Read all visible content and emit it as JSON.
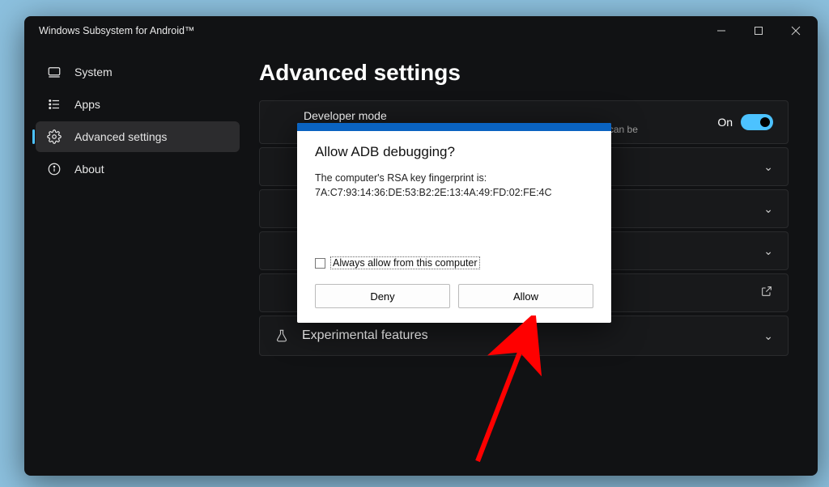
{
  "window": {
    "title": "Windows Subsystem for Android™"
  },
  "sidebar": {
    "items": [
      {
        "label": "System"
      },
      {
        "label": "Apps"
      },
      {
        "label": "Advanced settings"
      },
      {
        "label": "About"
      }
    ]
  },
  "page": {
    "title": "Advanced settings"
  },
  "devmode": {
    "title": "Developer mode",
    "subtitle": "Devices on the same private network can access the Subsystem. ADB can be",
    "state_label": "On"
  },
  "rows": {
    "experimental": "Experimental features"
  },
  "dialog": {
    "title": "Allow ADB debugging?",
    "line1": "The computer's RSA key fingerprint is:",
    "fingerprint": "7A:C7:93:14:36:DE:53:B2:2E:13:4A:49:FD:02:FE:4C",
    "checkbox_label": "Always allow from this computer",
    "deny": "Deny",
    "allow": "Allow"
  }
}
